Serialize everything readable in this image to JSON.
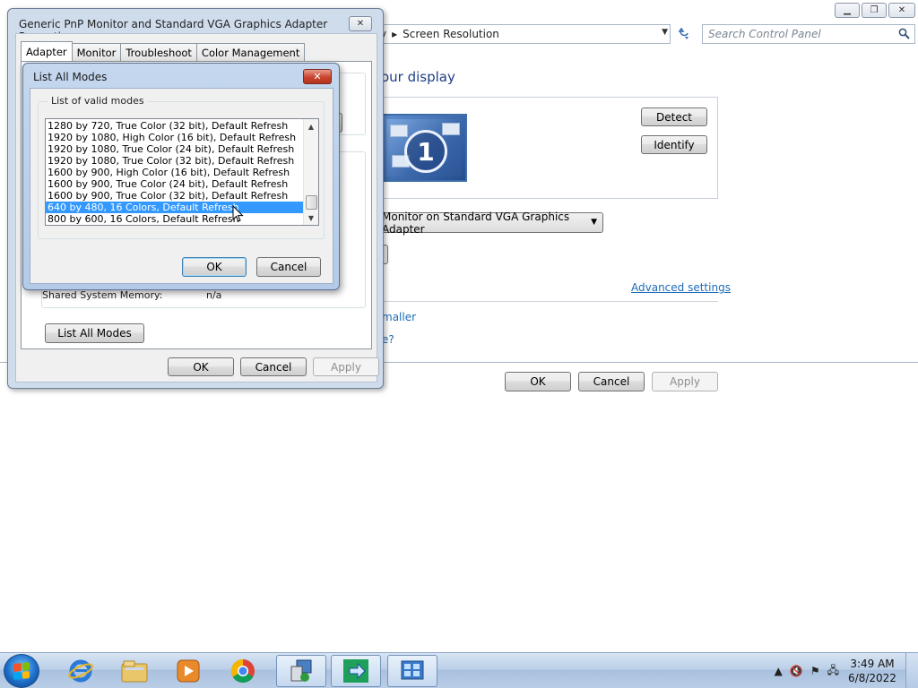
{
  "screen_resolution": {
    "window_buttons": {
      "minimize": "▁",
      "maximize": "❐",
      "close": "✕"
    },
    "breadcrumb": {
      "partial": "y",
      "arrow": "▸",
      "current": "Screen Resolution"
    },
    "search_placeholder": "Search Control Panel",
    "heading": "our display",
    "detect_label": "Detect",
    "identify_label": "Identify",
    "monitor_number": "1",
    "display_selection": "Monitor on Standard VGA Graphics Adapter",
    "advanced_settings_link": "Advanced settings",
    "link_fragment_1": "maller",
    "link_fragment_2": "e?",
    "ok_label": "OK",
    "cancel_label": "Cancel",
    "apply_label": "Apply"
  },
  "properties_dialog": {
    "title": "Generic PnP Monitor and Standard VGA Graphics Adapter Properties",
    "close_glyph": "✕",
    "tabs": [
      {
        "label": "Adapter",
        "active": true
      },
      {
        "label": "Monitor",
        "active": false
      },
      {
        "label": "Troubleshoot",
        "active": false
      },
      {
        "label": "Color Management",
        "active": false
      }
    ],
    "shared_memory_label": "Shared System Memory:",
    "shared_memory_value": "n/a",
    "list_all_modes_label": "List All Modes",
    "ok_label": "OK",
    "cancel_label": "Cancel",
    "apply_label": "Apply"
  },
  "list_all_modes_dialog": {
    "title": "List All Modes",
    "close_glyph": "✕",
    "group_label": "List of valid modes",
    "modes": [
      "1280 by 720, True Color (32 bit), Default Refresh",
      "1920 by 1080, High Color (16 bit), Default Refresh",
      "1920 by 1080, True Color (24 bit), Default Refresh",
      "1920 by 1080, True Color (32 bit), Default Refresh",
      "1600 by 900, High Color (16 bit), Default Refresh",
      "1600 by 900, True Color (24 bit), Default Refresh",
      "1600 by 900, True Color (32 bit), Default Refresh",
      "640 by 480, 16 Colors, Default Refresh",
      "800 by 600, 16 Colors, Default Refresh"
    ],
    "selected_index": 7,
    "ok_label": "OK",
    "cancel_label": "Cancel"
  },
  "taskbar": {
    "apps": [
      {
        "name": "internet-explorer",
        "active": false
      },
      {
        "name": "file-explorer",
        "active": false
      },
      {
        "name": "media-player",
        "active": false
      },
      {
        "name": "chrome",
        "active": false
      },
      {
        "name": "display-settings",
        "active": true
      },
      {
        "name": "remote-app",
        "active": true
      },
      {
        "name": "control-panel",
        "active": true
      }
    ],
    "tray": {
      "show_hidden": "▲",
      "volume": "🔇",
      "flag": "⚑",
      "network": "🖧"
    },
    "time": "3:49 AM",
    "date": "6/8/2022"
  },
  "colors": {
    "selection": "#3399ff",
    "link": "#1c6bb8",
    "heading": "#1e3e86",
    "taskbar": "#bcd0e8"
  }
}
